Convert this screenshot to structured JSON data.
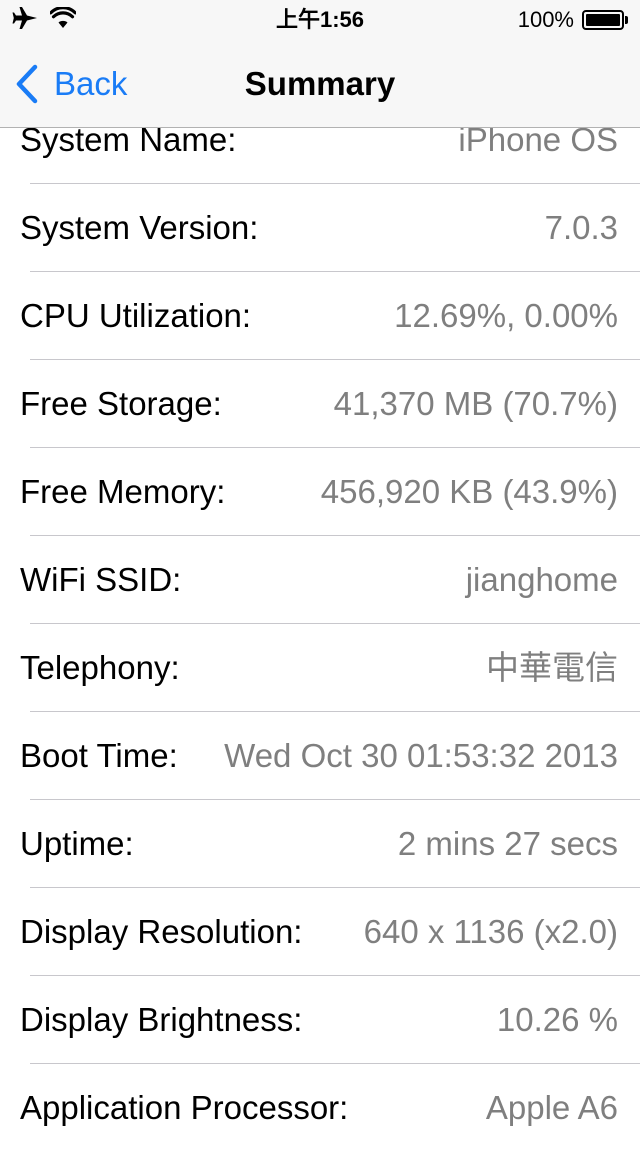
{
  "status_bar": {
    "time": "上午1:56",
    "battery_percent": "100%",
    "battery_level": 1.0,
    "icons": [
      "airplane-icon",
      "wifi-icon",
      "battery-icon"
    ]
  },
  "nav": {
    "back_label": "Back",
    "title": "Summary",
    "accent_color": "#1a7cf6"
  },
  "rows": [
    {
      "label": "System Name:",
      "value": "iPhone OS"
    },
    {
      "label": "System Version:",
      "value": "7.0.3"
    },
    {
      "label": "CPU Utilization:",
      "value": "12.69%, 0.00%"
    },
    {
      "label": "Free Storage:",
      "value": "41,370 MB (70.7%)"
    },
    {
      "label": "Free Memory:",
      "value": "456,920 KB (43.9%)"
    },
    {
      "label": "WiFi SSID:",
      "value": "jianghome"
    },
    {
      "label": "Telephony:",
      "value": "中華電信"
    },
    {
      "label": "Boot Time:",
      "value": "Wed Oct 30 01:53:32 2013"
    },
    {
      "label": "Uptime:",
      "value": "2 mins 27 secs"
    },
    {
      "label": "Display Resolution:",
      "value": "640 x 1136 (x2.0)"
    },
    {
      "label": "Display Brightness:",
      "value": "10.26 %"
    },
    {
      "label": "Application Processor:",
      "value": "Apple A6"
    }
  ]
}
